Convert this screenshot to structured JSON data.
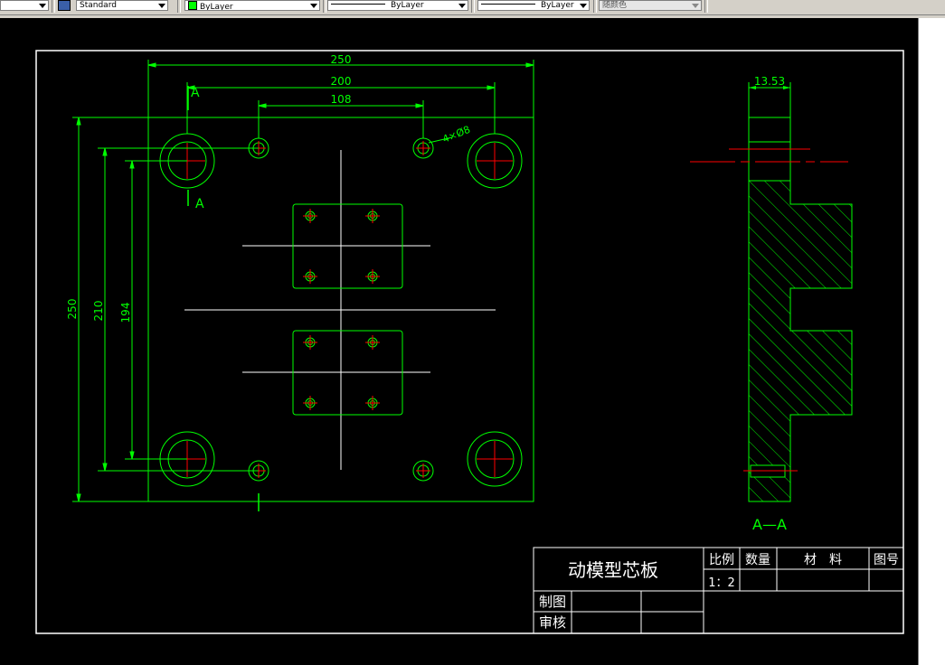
{
  "toolbar": {
    "text_style": "Standard",
    "layer_color_label": "ByLayer",
    "linetype_label": "ByLayer",
    "lineweight_label": "ByLayer",
    "plot_style": "随颜色"
  },
  "colors": {
    "background": "#000000",
    "outline": "#00ff00",
    "centerline": "#ff0000",
    "construction": "#ffffff",
    "frame": "#ffffff"
  },
  "drawing": {
    "dims": {
      "width_250": "250",
      "width_200": "200",
      "width_108": "108",
      "height_250": "250",
      "height_210": "210",
      "height_194": "194",
      "hole_note": "4×Ø8",
      "section_thickness": "13.53"
    },
    "section_labels": {
      "top": "A",
      "bottom": "A",
      "view_title": "A—A"
    }
  },
  "title_block": {
    "part_name": "动模型芯板",
    "scale_header": "比例",
    "qty_header": "数量",
    "material_header": "材　料",
    "drawing_no_header": "图号",
    "scale_value": "1：2",
    "drawn_by": "制图",
    "checked_by": "审核"
  }
}
